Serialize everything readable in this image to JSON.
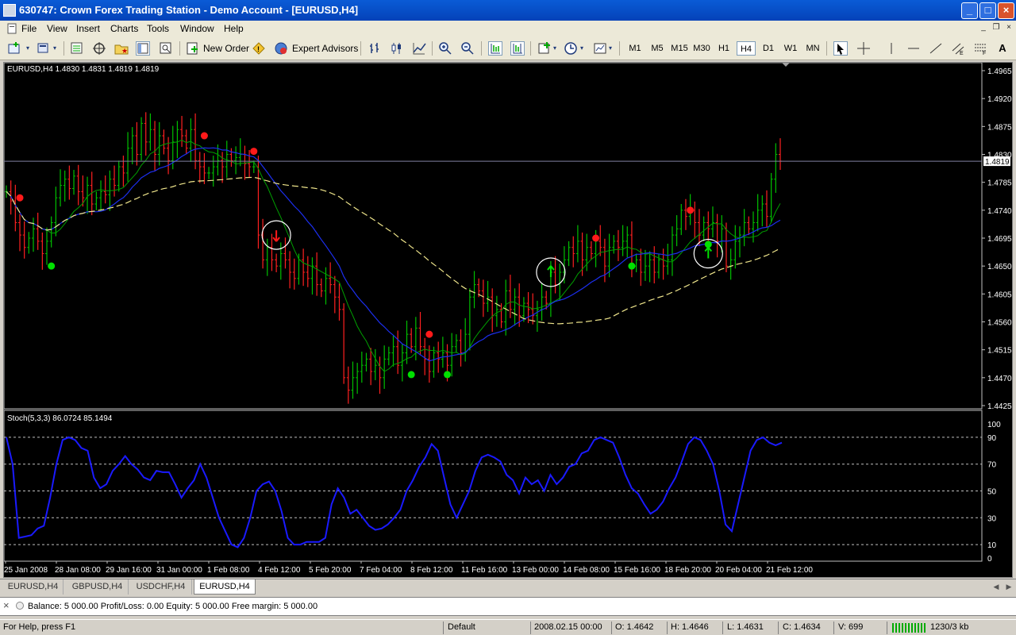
{
  "window": {
    "title": "630747: Crown Forex Trading Station - Demo Account - [EURUSD,H4]",
    "controls": [
      "_",
      "□",
      "×"
    ]
  },
  "menu": [
    "File",
    "View",
    "Insert",
    "Charts",
    "Tools",
    "Window",
    "Help"
  ],
  "toolbar": {
    "new_order": "New Order",
    "expert_advisors": "Expert Advisors",
    "timeframes": [
      "M1",
      "M5",
      "M15",
      "M30",
      "H1",
      "H4",
      "D1",
      "W1",
      "MN"
    ],
    "active_timeframe": "H4"
  },
  "chart": {
    "header": "EURUSD,H4  1.4830 1.4831 1.4819 1.4819",
    "price_labels": [
      "1.4965",
      "1.4920",
      "1.4875",
      "1.4830",
      "1.4785",
      "1.4740",
      "1.4695",
      "1.4650",
      "1.4605",
      "1.4560",
      "1.4515",
      "1.4470",
      "1.4425"
    ],
    "current_price": "1.4819",
    "date_labels": [
      "25 Jan 2008",
      "28 Jan 08:00",
      "29 Jan 16:00",
      "31 Jan 00:00",
      "1 Feb 08:00",
      "4 Feb 12:00",
      "5 Feb 20:00",
      "7 Feb 04:00",
      "8 Feb 12:00",
      "11 Feb 16:00",
      "13 Feb 00:00",
      "14 Feb 08:00",
      "15 Feb 16:00",
      "18 Feb 20:00",
      "20 Feb 04:00",
      "21 Feb 12:00"
    ],
    "colors": {
      "background": "#000000",
      "bull": "#00c000",
      "bear": "#ff2020",
      "ma_fast": "#00a000",
      "ma_slow": "#1c2ff0",
      "ma_long": "#f0e68c",
      "stoch": "#1a1aff",
      "buy_dot": "#00e000",
      "sell_dot": "#ff1a1a"
    }
  },
  "indicator": {
    "header": "Stoch(5,3,3) 86.0724 85.1494",
    "levels": [
      "100",
      "90",
      "70",
      "50",
      "30",
      "10",
      "0"
    ]
  },
  "tabs": [
    "EURUSD,H4",
    "GBPUSD,H4",
    "USDCHF,H4",
    "EURUSD,H4"
  ],
  "active_tab": 3,
  "terminal": {
    "text": "Balance: 5 000.00  Profit/Loss: 0.00  Equity: 5 000.00  Free margin: 5 000.00"
  },
  "status": {
    "help": "For Help, press F1",
    "profile": "Default",
    "datetime": "2008.02.15 00:00",
    "open": "O: 1.4642",
    "high": "H: 1.4646",
    "low": "L: 1.4631",
    "close": "C: 1.4634",
    "volume": "V: 699",
    "traffic": "1230/3 kb"
  },
  "chart_data": {
    "type": "candlestick",
    "symbol": "EURUSD",
    "timeframe": "H4",
    "ylim": [
      1.4425,
      1.4965
    ],
    "close": [
      1.477,
      1.4755,
      1.472,
      1.47,
      1.468,
      1.4695,
      1.471,
      1.469,
      1.467,
      1.469,
      1.472,
      1.476,
      1.478,
      1.479,
      1.4775,
      1.4795,
      1.477,
      1.476,
      1.478,
      1.475,
      1.476,
      1.477,
      1.4765,
      1.479,
      1.478,
      1.481,
      1.48,
      1.484,
      1.486,
      1.483,
      1.488,
      1.485,
      1.487,
      1.483,
      1.486,
      1.484,
      1.482,
      1.485,
      1.487,
      1.486,
      1.484,
      1.487,
      1.482,
      1.481,
      1.48,
      1.48,
      1.481,
      1.482,
      1.481,
      1.483,
      1.482,
      1.4825,
      1.483,
      1.4815,
      1.481,
      1.481,
      1.47,
      1.466,
      1.468,
      1.466,
      1.465,
      1.467,
      1.466,
      1.464,
      1.463,
      1.466,
      1.464,
      1.463,
      1.465,
      1.462,
      1.461,
      1.463,
      1.462,
      1.46,
      1.458,
      1.447,
      1.445,
      1.447,
      1.448,
      1.449,
      1.45,
      1.448,
      1.449,
      1.447,
      1.45,
      1.451,
      1.452,
      1.449,
      1.451,
      1.454,
      1.452,
      1.455,
      1.452,
      1.45,
      1.448,
      1.451,
      1.45,
      1.451,
      1.449,
      1.452,
      1.453,
      1.451,
      1.454,
      1.46,
      1.462,
      1.461,
      1.459,
      1.46,
      1.457,
      1.458,
      1.456,
      1.461,
      1.458,
      1.46,
      1.457,
      1.459,
      1.458,
      1.457,
      1.458,
      1.46,
      1.459,
      1.464,
      1.462,
      1.464,
      1.466,
      1.468,
      1.467,
      1.469,
      1.466,
      1.468,
      1.467,
      1.469,
      1.468,
      1.465,
      1.468,
      1.469,
      1.468,
      1.469,
      1.47,
      1.465,
      1.466,
      1.464,
      1.465,
      1.466,
      1.464,
      1.466,
      1.465,
      1.466,
      1.47,
      1.471,
      1.474,
      1.473,
      1.474,
      1.472,
      1.47,
      1.472,
      1.471,
      1.472,
      1.469,
      1.471,
      1.465,
      1.466,
      1.469,
      1.47,
      1.472,
      1.471,
      1.472,
      1.474,
      1.475,
      1.473,
      1.479,
      1.483,
      1.4819
    ],
    "stochastic": [
      90,
      70,
      15,
      16,
      17,
      22,
      24,
      45,
      70,
      88,
      90,
      88,
      82,
      80,
      60,
      52,
      55,
      65,
      70,
      76,
      70,
      66,
      60,
      58,
      65,
      64,
      64,
      55,
      45,
      52,
      58,
      70,
      60,
      45,
      30,
      20,
      10,
      8,
      15,
      30,
      50,
      55,
      57,
      50,
      35,
      15,
      10,
      10,
      12,
      12,
      12,
      15,
      40,
      52,
      45,
      33,
      36,
      30,
      24,
      21,
      22,
      25,
      30,
      36,
      50,
      58,
      68,
      75,
      85,
      80,
      60,
      40,
      30,
      40,
      50,
      65,
      75,
      77,
      75,
      72,
      62,
      58,
      48,
      60,
      55,
      58,
      50,
      62,
      55,
      60,
      68,
      70,
      78,
      80,
      88,
      90,
      88,
      86,
      75,
      62,
      52,
      48,
      40,
      33,
      36,
      42,
      52,
      60,
      72,
      85,
      90,
      88,
      80,
      70,
      50,
      25,
      20,
      40,
      60,
      80,
      88,
      90,
      86,
      84,
      86
    ],
    "buy_signals": [
      {
        "bar": 10,
        "price": 1.465
      },
      {
        "bar": 90,
        "price": 1.4475
      },
      {
        "bar": 98,
        "price": 1.4475
      },
      {
        "bar": 139,
        "price": 1.465
      },
      {
        "bar": 156,
        "price": 1.4685
      }
    ],
    "sell_signals": [
      {
        "bar": 3,
        "price": 1.476
      },
      {
        "bar": 44,
        "price": 1.486
      },
      {
        "bar": 55,
        "price": 1.4835
      },
      {
        "bar": 94,
        "price": 1.454
      },
      {
        "bar": 131,
        "price": 1.4695
      },
      {
        "bar": 152,
        "price": 1.474
      }
    ],
    "arrows": [
      {
        "bar": 60,
        "price": 1.47,
        "dir": "down"
      },
      {
        "bar": 121,
        "price": 1.464,
        "dir": "up"
      },
      {
        "bar": 156,
        "price": 1.467,
        "dir": "up"
      }
    ]
  }
}
